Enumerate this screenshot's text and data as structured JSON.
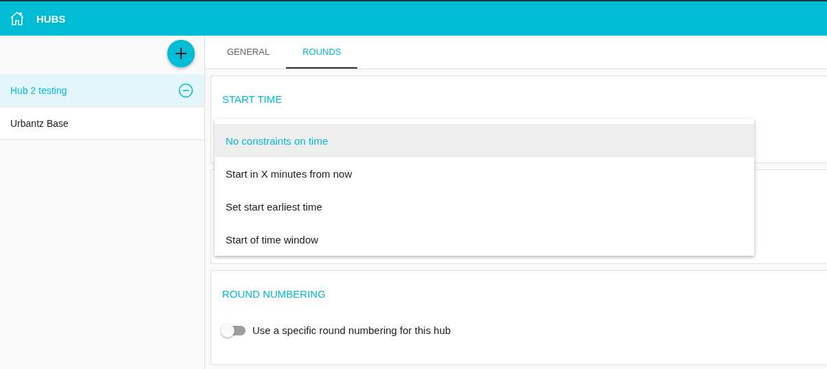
{
  "header": {
    "title": "HUBS"
  },
  "sidebar": {
    "items": [
      {
        "label": "Hub 2 testing",
        "selected": true
      },
      {
        "label": "Urbantz Base",
        "selected": false
      }
    ]
  },
  "tabs": [
    {
      "label": "GENERAL",
      "selected": false
    },
    {
      "label": "ROUNDS",
      "selected": true
    }
  ],
  "sections": [
    {
      "kind": "select",
      "title": "START TIME"
    },
    {
      "kind": "blank"
    },
    {
      "kind": "toggle",
      "title": "ROUND NUMBERING",
      "toggle": {
        "label": "Use a specific round numbering for this hub",
        "on": false
      }
    }
  ],
  "menu": {
    "options": [
      {
        "label": "No constraints on time",
        "selected": true
      },
      {
        "label": "Start in X minutes from now",
        "selected": false
      },
      {
        "label": "Set start earliest time",
        "selected": false
      },
      {
        "label": "Start of time window",
        "selected": false
      }
    ]
  }
}
